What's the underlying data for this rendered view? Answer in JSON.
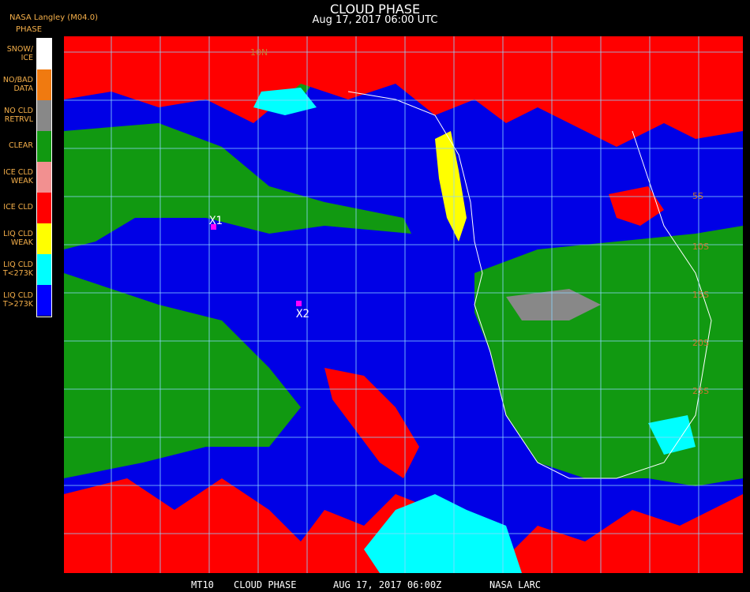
{
  "header": {
    "title": "CLOUD PHASE",
    "subtitle": "Aug 17, 2017 06:00 UTC",
    "provider": "NASA Langley (M04.0)"
  },
  "legend": {
    "title": "PHASE",
    "items": [
      {
        "label": "SNOW/\nICE",
        "color": "#ffffff"
      },
      {
        "label": "NO/BAD\nDATA",
        "color": "#f07a10"
      },
      {
        "label": "NO CLD\nRETRVL",
        "color": "#888888"
      },
      {
        "label": "CLEAR",
        "color": "#119911"
      },
      {
        "label": "ICE CLD\nWEAK",
        "color": "#f29090"
      },
      {
        "label": "ICE CLD",
        "color": "#ff0000"
      },
      {
        "label": "LIQ CLD\nWEAK",
        "color": "#ffff00"
      },
      {
        "label": "LIQ CLD\nT<273K",
        "color": "#00ffff"
      },
      {
        "label": "LIQ CLD\nT>273K",
        "color": "#0000ff"
      }
    ]
  },
  "map": {
    "grid_labels": [
      "10N",
      "5S",
      "10S",
      "15S",
      "20S",
      "25S"
    ],
    "markers": [
      {
        "label": "X1",
        "color": "#ff00ff"
      },
      {
        "label": "X2",
        "color": "#ff00ff"
      }
    ]
  },
  "footer": {
    "satellite": "MT10",
    "product": "CLOUD PHASE",
    "datetime": "AUG 17, 2017 06:00Z",
    "org": "NASA LARC"
  }
}
